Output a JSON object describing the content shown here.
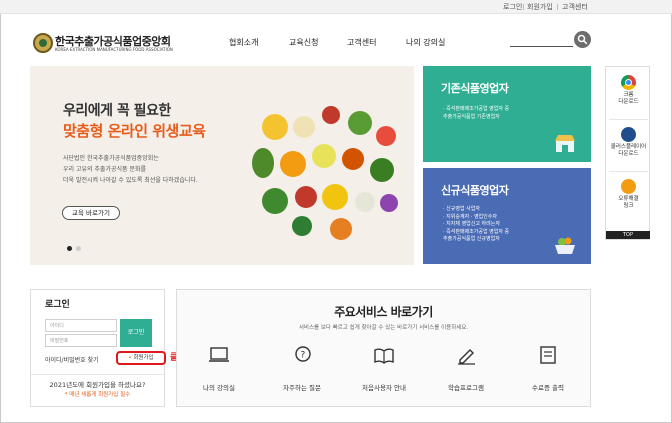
{
  "util": {
    "login": "로그인",
    "join": "회원가입",
    "customer": "고객센터"
  },
  "header": {
    "logo_title": "한국추출가공식품업중앙회",
    "logo_sub": "KOREA EXTRACTION MANUFACTURING FOOD ASSOCIATION",
    "nav": [
      "협회소개",
      "교육신청",
      "고객센터",
      "나의 강의실"
    ]
  },
  "hero": {
    "line1": "우리에게 꼭 필요한",
    "line2": "맞춤형 온라인 위생교육",
    "desc": "사단법인 한국추출가공식품업중앙회는\n우리 고유의 추출가공식품 문화를\n더욱 발전시켜 나아갈 수 있도록 최선을 다하겠습니다.",
    "button": "교육 바로가기"
  },
  "tiles": {
    "existing": {
      "title": "기존식품영업자",
      "items": [
        "· 즉석판매제조가공업 영업자 중",
        "  추출가공식품업 기존영업자"
      ]
    },
    "new": {
      "title": "신규식품영업자",
      "items": [
        "· 신규영업 사업자",
        "· 지위승계자 · 영업인수자",
        "· 지자체 영업신고 하려는자",
        "· 즉석판매제조가공업 영업자 중",
        "  추출가공식품업 신규영업자"
      ]
    }
  },
  "side": {
    "chrome": [
      "크롬",
      "다운로드"
    ],
    "player": [
      "콜러스플레이어",
      "다운로드"
    ],
    "error": [
      "오류해결",
      "링크"
    ],
    "top": "TOP"
  },
  "login": {
    "title": "로그인",
    "id_placeholder": "아이디",
    "pw_placeholder": "비밀번호",
    "button": "로그인",
    "find": "아이디/비밀번호 찾기",
    "join": "회원가입",
    "question": "2021년도에 회원가입을 하셨나요?",
    "note": "* 매년 새롭게 회원가입 필수",
    "click": "클릭"
  },
  "services": {
    "title": "주요서비스 바로가기",
    "subtitle": "서비스를 보다 빠르고 쉽게 찾아갈 수 있는 바로가기 서비스를 이용하세요.",
    "items": [
      "나의 강의실",
      "자주하는 질문",
      "처음사용자 안내",
      "학습프로그램",
      "수료증 출력"
    ]
  },
  "colors": {
    "accent_green": "#2fae93",
    "accent_blue": "#4a6cb5",
    "accent_orange": "#e85c1a",
    "click_red": "#e0171c"
  }
}
